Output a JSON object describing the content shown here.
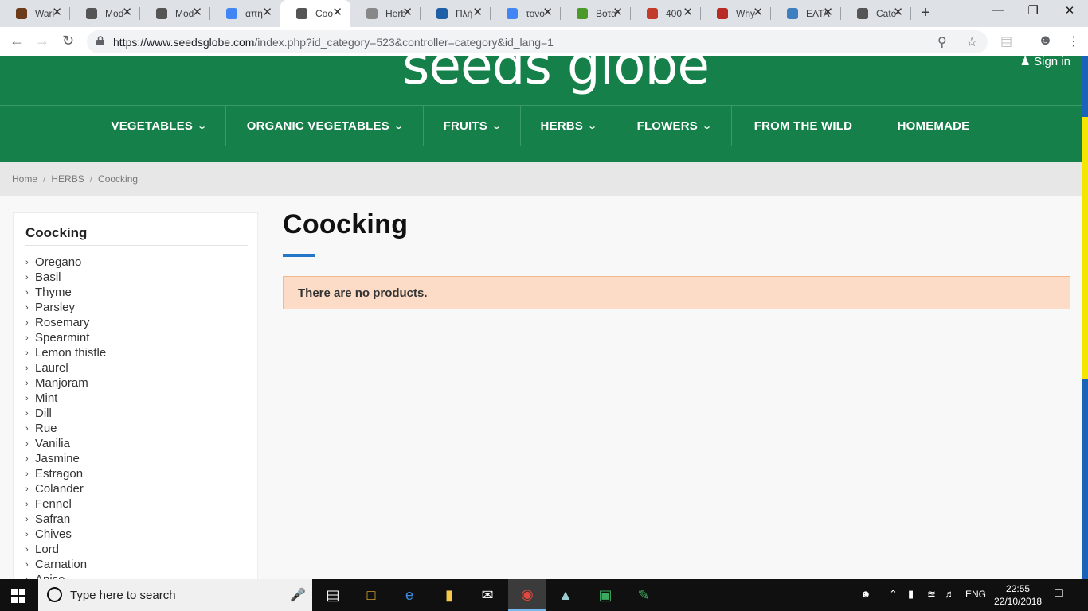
{
  "browser": {
    "tabs": [
      {
        "title": "Wari",
        "favicon_color": "#6b3b1a",
        "icon": "book-icon"
      },
      {
        "title": "Mod",
        "favicon_color": "#555555",
        "icon": "seedsglobe-icon"
      },
      {
        "title": "Mod",
        "favicon_color": "#555555",
        "icon": "seedsglobe-icon"
      },
      {
        "title": "απη",
        "favicon_color": "#4285f4",
        "icon": "google-icon"
      },
      {
        "title": "Coo",
        "favicon_color": "#555555",
        "icon": "seedsglobe-icon",
        "active": true
      },
      {
        "title": "Herb",
        "favicon_color": "#888888",
        "icon": "herb-icon"
      },
      {
        "title": "Πλή",
        "favicon_color": "#1f5fa8",
        "icon": "globe-icon"
      },
      {
        "title": "τονο",
        "favicon_color": "#4285f4",
        "icon": "google-icon"
      },
      {
        "title": "Βότα",
        "favicon_color": "#4a9a2a",
        "icon": "plant-icon"
      },
      {
        "title": "400",
        "favicon_color": "#c33b2a",
        "icon": "bars-icon"
      },
      {
        "title": "Why",
        "favicon_color": "#b92b27",
        "icon": "quora-icon"
      },
      {
        "title": "ΕΛΤΑ",
        "favicon_color": "#3d7fc0",
        "icon": "elta-icon"
      },
      {
        "title": "Cate",
        "favicon_color": "#555555",
        "icon": "seedsglobe-icon"
      }
    ],
    "new_tab_label": "+",
    "window_controls": {
      "minimize": "—",
      "restore": "❐",
      "close": "✕"
    },
    "url_host": "https://www.seedsglobe.com",
    "url_path": "/index.php?id_category=523&controller=category&id_lang=1"
  },
  "site": {
    "logo_text": "seeds globe",
    "signin_label": "Sign in",
    "nav": [
      {
        "label": "VEGETABLES",
        "has_dropdown": true
      },
      {
        "label": "ORGANIC VEGETABLES",
        "has_dropdown": true
      },
      {
        "label": "FRUITS",
        "has_dropdown": true
      },
      {
        "label": "HERBS",
        "has_dropdown": true
      },
      {
        "label": "FLOWERS",
        "has_dropdown": true
      },
      {
        "label": "FROM THE WILD",
        "has_dropdown": false
      },
      {
        "label": "HOMEMADE",
        "has_dropdown": false
      }
    ],
    "breadcrumb": [
      "Home",
      "HERBS",
      "Coocking"
    ],
    "brand_green": "#15804a",
    "accent_blue": "#2477c7"
  },
  "sidebar": {
    "title": "Coocking",
    "items": [
      "Oregano",
      "Basil",
      "Thyme",
      "Parsley",
      "Rosemary",
      "Spearmint",
      "Lemon thistle",
      "Laurel",
      "Manjoram",
      "Mint",
      "Dill",
      "Rue",
      "Vanilia",
      "Jasmine",
      "Estragon",
      "Colander",
      "Fennel",
      "Safran",
      "Chives",
      "Lord",
      "Carnation",
      "Anise"
    ]
  },
  "main": {
    "title": "Coocking",
    "alert": "There are no products."
  },
  "taskbar": {
    "search_placeholder": "Type here to search",
    "language": "ENG",
    "time": "22:55",
    "date": "22/10/2018"
  }
}
